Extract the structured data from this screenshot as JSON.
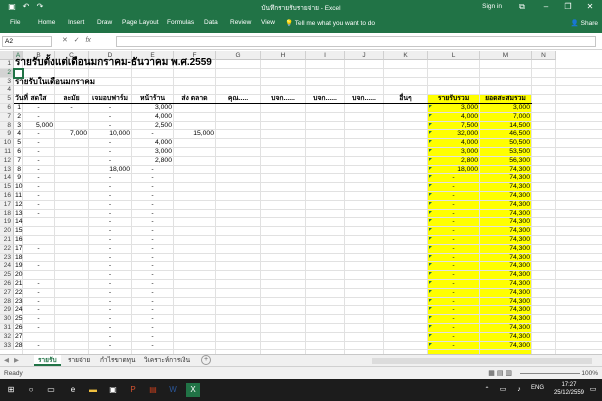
{
  "window": {
    "title": "บันทึกรายรับรายจ่าย - Excel",
    "signin": "Sign in"
  },
  "ribbon": {
    "tabs": [
      "File",
      "Home",
      "Insert",
      "Draw",
      "Page Layout",
      "Formulas",
      "Data",
      "Review",
      "View"
    ],
    "tell_me": "Tell me what you want to do",
    "share": "Share"
  },
  "formula_bar": {
    "name_box": "A2",
    "value": ""
  },
  "columns": [
    "A",
    "B",
    "C",
    "D",
    "E",
    "F",
    "G",
    "H",
    "I",
    "J",
    "K",
    "L",
    "M",
    "N"
  ],
  "rows": [
    "1",
    "2",
    "3",
    "4",
    "5",
    "6",
    "7",
    "8",
    "9",
    "10",
    "11",
    "12",
    "13",
    "14",
    "15",
    "16",
    "17",
    "18",
    "19",
    "20",
    "21",
    "22",
    "23",
    "24",
    "25",
    "26",
    "27",
    "28",
    "29",
    "30",
    "31",
    "32",
    "33"
  ],
  "sheet": {
    "title": "รายรับตั้งแต่เดือนมกราคม-ธันวาคม พ.ศ.2559",
    "subtitle": "รายรับในเดือนมกราคม",
    "headers": [
      "วันที่",
      "สดใส",
      "ละมัย",
      "เจมอบฟาร์ม",
      "หน้าร้าน",
      "ส่ง ตลาด",
      "คุณ.....",
      "บจก......",
      "บจก......",
      "บจก......",
      "อื่นๆ",
      "รายรับรวม",
      "ยอดสะสมรวม"
    ],
    "data_rows": [
      {
        "a": "1",
        "b": "-",
        "c": "-",
        "d": "-",
        "e": "3,000",
        "f": "",
        "l": "3,000",
        "m": "3,000"
      },
      {
        "a": "2",
        "b": "-",
        "c": "",
        "d": "-",
        "e": "4,000",
        "f": "",
        "l": "4,000",
        "m": "7,000"
      },
      {
        "a": "3",
        "b": "5,000",
        "c": "",
        "d": "-",
        "e": "2,500",
        "f": "",
        "l": "7,500",
        "m": "14,500"
      },
      {
        "a": "4",
        "b": "-",
        "c": "7,000",
        "d": "10,000",
        "e": "-",
        "f": "15,000",
        "l": "32,000",
        "m": "46,500"
      },
      {
        "a": "5",
        "b": "-",
        "c": "",
        "d": "-",
        "e": "4,000",
        "f": "",
        "l": "4,000",
        "m": "50,500"
      },
      {
        "a": "6",
        "b": "-",
        "c": "",
        "d": "-",
        "e": "3,000",
        "f": "",
        "l": "3,000",
        "m": "53,500"
      },
      {
        "a": "7",
        "b": "-",
        "c": "",
        "d": "-",
        "e": "2,800",
        "f": "",
        "l": "2,800",
        "m": "56,300"
      },
      {
        "a": "8",
        "b": "-",
        "c": "",
        "d": "18,000",
        "e": "-",
        "f": "",
        "l": "18,000",
        "m": "74,300"
      },
      {
        "a": "9",
        "b": "-",
        "c": "",
        "d": "-",
        "e": "-",
        "f": "",
        "l": "-",
        "m": "74,300"
      },
      {
        "a": "10",
        "b": "-",
        "c": "",
        "d": "-",
        "e": "-",
        "f": "",
        "l": "-",
        "m": "74,300"
      },
      {
        "a": "11",
        "b": "-",
        "c": "",
        "d": "-",
        "e": "-",
        "f": "",
        "l": "-",
        "m": "74,300"
      },
      {
        "a": "12",
        "b": "-",
        "c": "",
        "d": "-",
        "e": "-",
        "f": "",
        "l": "-",
        "m": "74,300"
      },
      {
        "a": "13",
        "b": "-",
        "c": "",
        "d": "-",
        "e": "-",
        "f": "",
        "l": "-",
        "m": "74,300"
      },
      {
        "a": "14",
        "b": "",
        "c": "",
        "d": "-",
        "e": "-",
        "f": "",
        "l": "-",
        "m": "74,300"
      },
      {
        "a": "15",
        "b": "",
        "c": "",
        "d": "-",
        "e": "-",
        "f": "",
        "l": "-",
        "m": "74,300"
      },
      {
        "a": "16",
        "b": "",
        "c": "",
        "d": "-",
        "e": "-",
        "f": "",
        "l": "-",
        "m": "74,300"
      },
      {
        "a": "17",
        "b": "-",
        "c": "",
        "d": "-",
        "e": "-",
        "f": "",
        "l": "-",
        "m": "74,300"
      },
      {
        "a": "18",
        "b": "",
        "c": "",
        "d": "-",
        "e": "-",
        "f": "",
        "l": "-",
        "m": "74,300"
      },
      {
        "a": "19",
        "b": "-",
        "c": "",
        "d": "-",
        "e": "-",
        "f": "",
        "l": "-",
        "m": "74,300"
      },
      {
        "a": "20",
        "b": "",
        "c": "",
        "d": "-",
        "e": "-",
        "f": "",
        "l": "-",
        "m": "74,300"
      },
      {
        "a": "21",
        "b": "-",
        "c": "",
        "d": "-",
        "e": "-",
        "f": "",
        "l": "-",
        "m": "74,300"
      },
      {
        "a": "22",
        "b": "-",
        "c": "",
        "d": "-",
        "e": "-",
        "f": "",
        "l": "-",
        "m": "74,300"
      },
      {
        "a": "23",
        "b": "-",
        "c": "",
        "d": "-",
        "e": "-",
        "f": "",
        "l": "-",
        "m": "74,300"
      },
      {
        "a": "24",
        "b": "-",
        "c": "",
        "d": "-",
        "e": "-",
        "f": "",
        "l": "-",
        "m": "74,300"
      },
      {
        "a": "25",
        "b": "-",
        "c": "",
        "d": "-",
        "e": "-",
        "f": "",
        "l": "-",
        "m": "74,300"
      },
      {
        "a": "26",
        "b": "-",
        "c": "",
        "d": "-",
        "e": "-",
        "f": "",
        "l": "-",
        "m": "74,300"
      },
      {
        "a": "27",
        "b": "",
        "c": "",
        "d": "-",
        "e": "-",
        "f": "",
        "l": "-",
        "m": "74,300"
      },
      {
        "a": "28",
        "b": "-",
        "c": "",
        "d": "-",
        "e": "-",
        "f": "",
        "l": "-",
        "m": "74,300"
      }
    ]
  },
  "sheet_tabs": [
    "รายรับ",
    "รายจ่าย",
    "กำไรขาดทุน",
    "วิเคราะห์การเงิน"
  ],
  "status": {
    "ready": "Ready",
    "zoom": "100%"
  },
  "taskbar": {
    "lang": "ENG",
    "time": "17:27",
    "date": "25/12/2559"
  },
  "colors": {
    "excel_green": "#217346",
    "highlight": "#ffff00"
  }
}
